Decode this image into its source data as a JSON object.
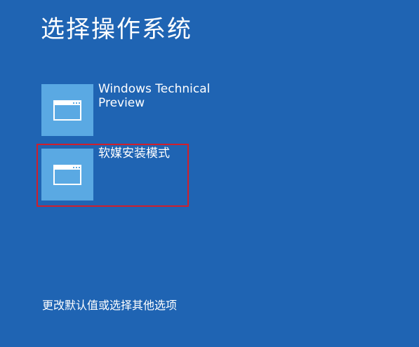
{
  "screen": {
    "title": "选择操作系统",
    "options": [
      {
        "label": "Windows Technical Preview",
        "icon": "window-icon"
      },
      {
        "label": "软媒安装模式",
        "icon": "window-icon"
      }
    ],
    "footer_link": "更改默认值或选择其他选项"
  },
  "colors": {
    "background": "#1f64b3",
    "tile": "#5aa9e3",
    "highlight_border": "#d11f2b",
    "text": "#ffffff"
  }
}
